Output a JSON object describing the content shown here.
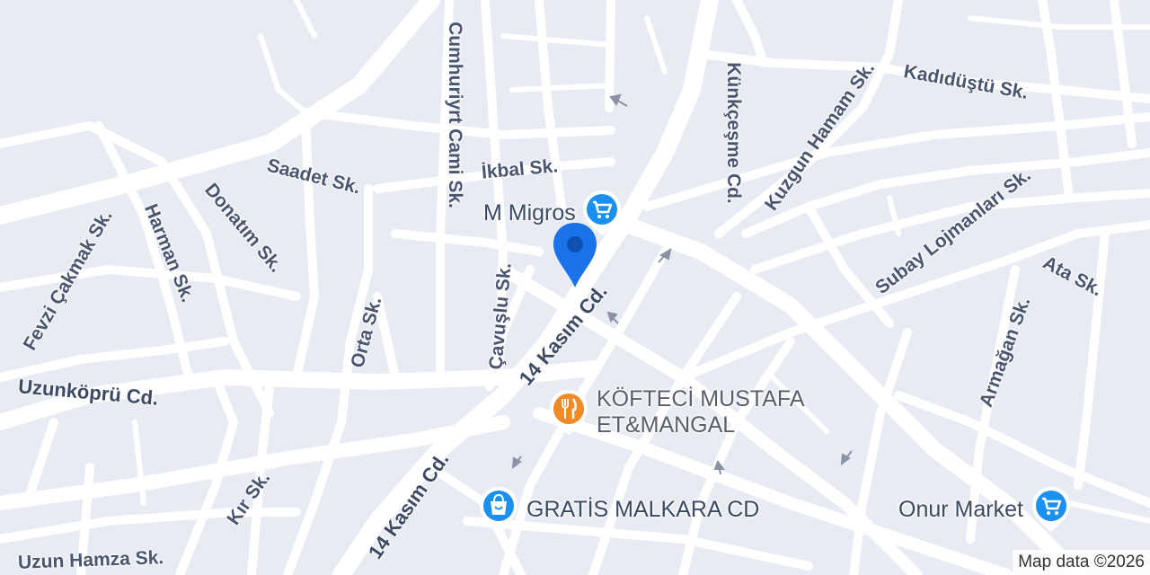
{
  "map": {
    "streets": [
      {
        "id": "cumhuriyet-cami",
        "label": "Cumhuriyrt Cami Sk."
      },
      {
        "id": "kunkcesme",
        "label": "Künkçeşme Cd."
      },
      {
        "id": "kadidustu",
        "label": "Kadıdüştü Sk."
      },
      {
        "id": "kuzgun-hamam",
        "label": "Kuzgun Hamam Sk."
      },
      {
        "id": "saadet",
        "label": "Saadet Sk."
      },
      {
        "id": "ikbal",
        "label": "İkbal Sk."
      },
      {
        "id": "subay-lojmanlari",
        "label": "Subay Lojmanları Sk."
      },
      {
        "id": "fevzi-cakmak",
        "label": "Fevzi Çakmak Sk."
      },
      {
        "id": "harman",
        "label": "Harman Sk."
      },
      {
        "id": "donatim",
        "label": "Donatım Sk."
      },
      {
        "id": "cavuslu",
        "label": "Çavuşlu Sk."
      },
      {
        "id": "ata",
        "label": "Ata Sk."
      },
      {
        "id": "orta",
        "label": "Orta Sk."
      },
      {
        "id": "armagan",
        "label": "Armağan Sk."
      },
      {
        "id": "14-kasim-upper",
        "label": "14 Kasım Cd."
      },
      {
        "id": "uzunkopru",
        "label": "Uzunköprü Cd."
      },
      {
        "id": "kir",
        "label": "Kır Sk."
      },
      {
        "id": "14-kasim-lower",
        "label": "14 Kasım Cd."
      },
      {
        "id": "uzun-hamza",
        "label": "Uzun Hamza Sk."
      }
    ],
    "pois": [
      {
        "id": "m-migros",
        "name": "M Migros",
        "icon": "shopping-cart-icon",
        "color": "#1a91f0"
      },
      {
        "id": "kofteci-mustafa",
        "name_line1": "KÖFTECİ MUSTAFA",
        "name_line2": "ET&MANGAL",
        "icon": "fork-knife-icon",
        "color": "#f08a24"
      },
      {
        "id": "gratis",
        "name": "GRATİS MALKARA CD",
        "icon": "shopping-bag-icon",
        "color": "#1a91f0"
      },
      {
        "id": "onur-market",
        "name": "Onur Market",
        "icon": "shopping-cart-icon",
        "color": "#1a91f0"
      }
    ],
    "marker": {
      "type": "location-pin",
      "color": "#1a73e8"
    },
    "attribution": "Map data ©2026",
    "colors": {
      "background": "#e8ebf4",
      "road": "#ffffff",
      "arrow": "#8a93a6"
    }
  }
}
